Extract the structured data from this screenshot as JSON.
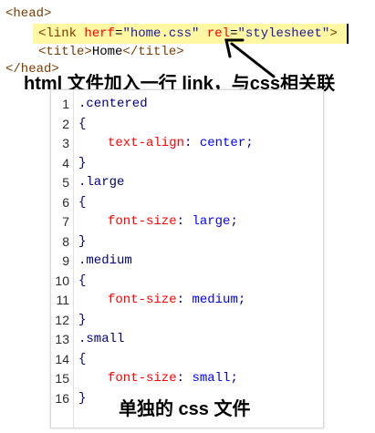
{
  "html_snippet": {
    "line1": "<head>",
    "line2": {
      "tag_open": "<link ",
      "attr1_name": "herf",
      "attr1_eq": "=",
      "attr1_value": "\"home.css\"",
      "space": " ",
      "attr2_name": "rel",
      "attr2_eq": "=",
      "attr2_value": "\"stylesheet\"",
      "tag_close": ">"
    },
    "line3": {
      "open": "<title>",
      "text": "Home",
      "close": "</title>"
    },
    "line4": "</head>"
  },
  "caption_top": "html 文件加入一行 link，与css相关联",
  "css_file": {
    "lines": [
      {
        "n": "1",
        "kind": "selector",
        "text": ".centered"
      },
      {
        "n": "2",
        "kind": "brace",
        "text": "{"
      },
      {
        "n": "3",
        "kind": "decl",
        "prop": "text-align",
        "colon": ": ",
        "value": "center",
        "semi": ";"
      },
      {
        "n": "4",
        "kind": "brace",
        "text": "}"
      },
      {
        "n": "5",
        "kind": "selector",
        "text": ".large"
      },
      {
        "n": "6",
        "kind": "brace",
        "text": "{"
      },
      {
        "n": "7",
        "kind": "decl",
        "prop": "font-size",
        "colon": ": ",
        "value": "large",
        "semi": ";"
      },
      {
        "n": "8",
        "kind": "brace",
        "text": "}"
      },
      {
        "n": "9",
        "kind": "selector",
        "text": ".medium"
      },
      {
        "n": "10",
        "kind": "brace",
        "text": "{"
      },
      {
        "n": "11",
        "kind": "decl",
        "prop": "font-size",
        "colon": ": ",
        "value": "medium",
        "semi": ";"
      },
      {
        "n": "12",
        "kind": "brace",
        "text": "}"
      },
      {
        "n": "13",
        "kind": "selector",
        "text": ".small"
      },
      {
        "n": "14",
        "kind": "brace",
        "text": "{"
      },
      {
        "n": "15",
        "kind": "decl",
        "prop": "font-size",
        "colon": ": ",
        "value": "small",
        "semi": ";"
      },
      {
        "n": "16",
        "kind": "brace",
        "text": "}"
      }
    ]
  },
  "caption_bottom": "单独的 css 文件",
  "colors": {
    "highlight": "#fff7a1",
    "tag": "#7b3b00",
    "attribute": "#ff0000",
    "string": "#1a1aa6",
    "css_selector": "#000080",
    "css_property": "#ff0000",
    "css_value": "#0000ff"
  }
}
